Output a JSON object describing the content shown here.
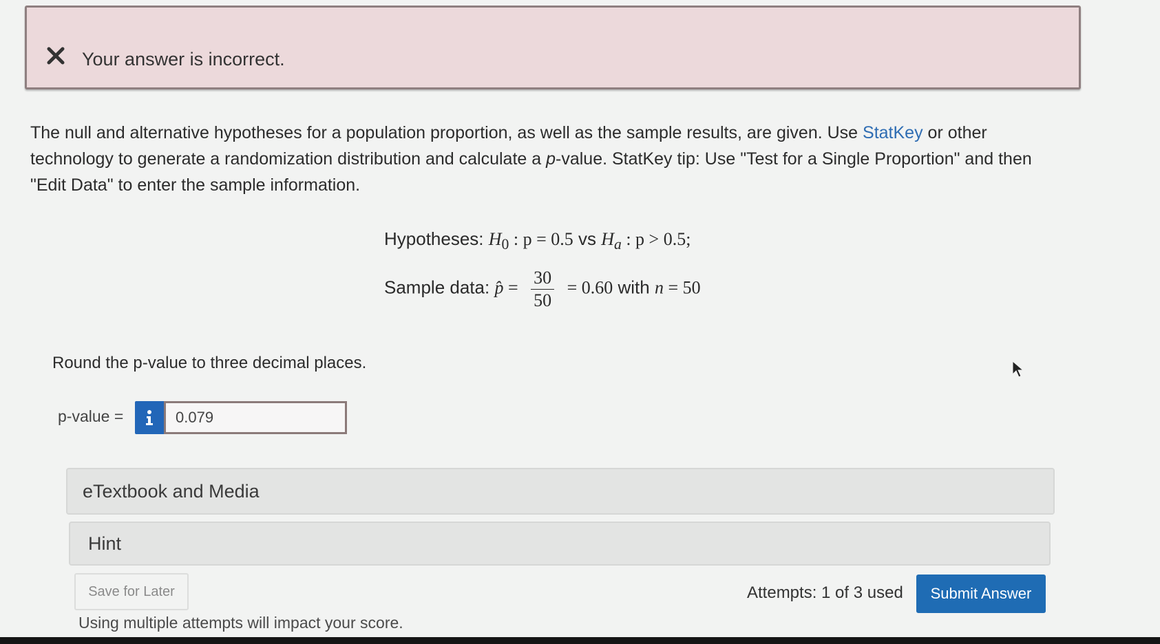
{
  "banner": {
    "message": "Your answer is incorrect.",
    "icon": "x-mark-icon",
    "color": "#ecd9db"
  },
  "question": {
    "part1": "The null and alternative hypotheses for a population proportion, as well as the sample results, are given. Use ",
    "link": "StatKey",
    "part2": " or other technology to generate a randomization distribution and calculate a ",
    "pvar": "p",
    "part3": "-value. StatKey tip: Use \"Test for a Single Proportion\" and then \"Edit Data\" to enter the sample information."
  },
  "math": {
    "hyp_label": "Hypotheses: ",
    "h0": "H",
    "h0_sub": "0",
    "h0_rel": " : p = 0.5",
    "vs": " vs ",
    "ha": "H",
    "ha_sub": "a",
    "ha_rel": " : p > 0.5;",
    "sample_label": "Sample data: ",
    "phat": "p̂",
    "eq": " = ",
    "num": "30",
    "den": "50",
    "result": " = 0.60",
    "with": " with ",
    "n": "n",
    "n_val": " = 50"
  },
  "instruction": "Round the p-value to three decimal places.",
  "answer": {
    "label": "p-value =",
    "value": "0.079",
    "info_icon": "info-icon"
  },
  "sections": {
    "etextbook": "eTextbook and Media",
    "hint": "Hint"
  },
  "footer": {
    "save_label": "Save for Later",
    "attempts": "Attempts: 1 of 3 used",
    "submit_label": "Submit Answer",
    "warning": "Using multiple attempts will impact your score.",
    "accent": "#1f6cb4"
  }
}
